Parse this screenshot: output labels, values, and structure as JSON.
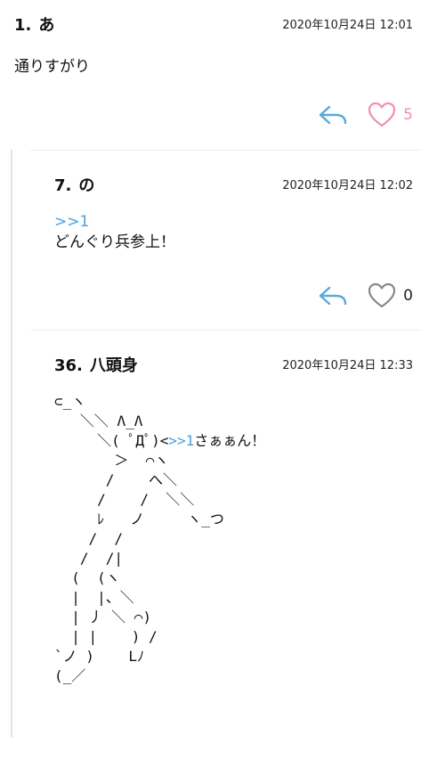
{
  "posts": [
    {
      "number": "1.",
      "name": "あ",
      "date": "2020年10月24日 12:01",
      "body": "通りすがり",
      "likes": "5"
    },
    {
      "number": "7.",
      "name": "の",
      "date": "2020年10月24日 12:02",
      "anchor": ">>1",
      "body": "どんぐり兵参上！",
      "likes": "0"
    },
    {
      "number": "36.",
      "name": "八頭身",
      "date": "2020年10月24日 12:33",
      "aa_before": "⊂_ヽ\n   ＼＼ Λ_Λ\n     ＼( ﾟДﾟ)<",
      "anchor": ">>1",
      "aa_after": "さぁぁん！\n       ＞  ⌒ヽ\n      /    へ＼\n     /    /  ＼＼\n     ﾚ   ノ     ヽ_つ\n    /  /\n   /  /|\n  (  (ヽ\n  |  |、＼\n  | 丿 ＼ ⌒)\n  | |    ) /\n`ノ )    Lﾉ\n(_／"
    }
  ],
  "colors": {
    "reply_icon": "#5aa9dc",
    "heart_liked": "#f08fb6",
    "heart_default": "#888888",
    "anchor": "#4a9fd8"
  },
  "icons": {
    "reply": "reply-arrow-icon",
    "like": "heart-icon"
  }
}
